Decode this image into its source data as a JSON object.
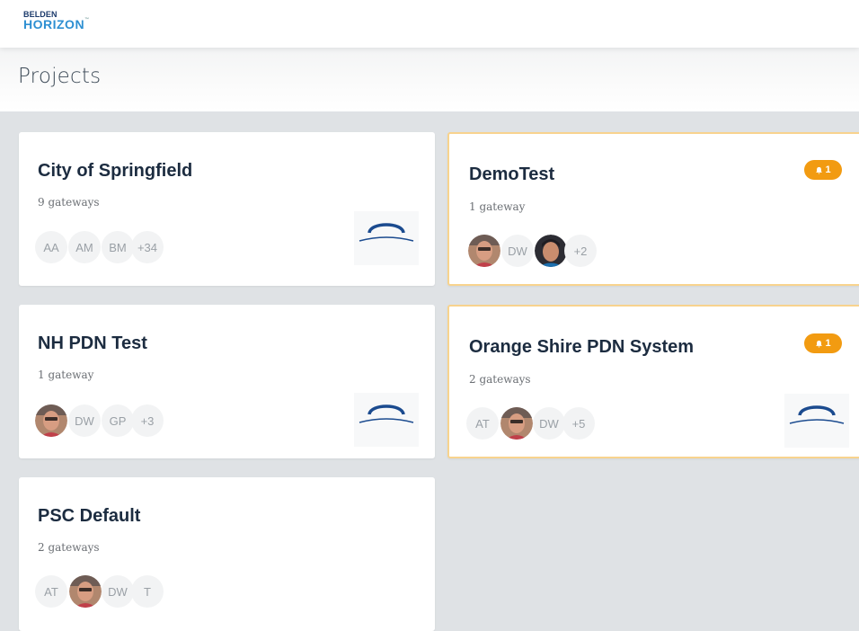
{
  "brand": {
    "line1": "BELDEN",
    "line2": "HORIZON",
    "tm": "™"
  },
  "page": {
    "title": "Projects"
  },
  "projects": [
    {
      "name": "City of Springfield",
      "gateways": "9 gateways",
      "members": [
        "AA",
        "AM",
        "BM",
        "+34"
      ],
      "has_logo": true
    },
    {
      "name": "DemoTest",
      "gateways": "1 gateway",
      "members": [
        "photo-red",
        "DW",
        "photo-dark",
        "+2"
      ],
      "alert_count": "1"
    },
    {
      "name": "NH PDN Test",
      "gateways": "1 gateway",
      "members": [
        "photo-red",
        "DW",
        "GP",
        "+3"
      ],
      "has_logo": true
    },
    {
      "name": "Orange Shire PDN System",
      "gateways": "2 gateways",
      "members": [
        "AT",
        "photo-red",
        "DW",
        "+5"
      ],
      "alert_count": "1",
      "has_logo": true
    },
    {
      "name": "PSC Default",
      "gateways": "2 gateways",
      "members": [
        "AT",
        "photo-red",
        "DW",
        "T"
      ]
    }
  ],
  "colors": {
    "accent": "#f29b11",
    "title": "#1c2c40",
    "brand_blue": "#2d8fd2",
    "logo_arc": "#1b4b8f"
  }
}
